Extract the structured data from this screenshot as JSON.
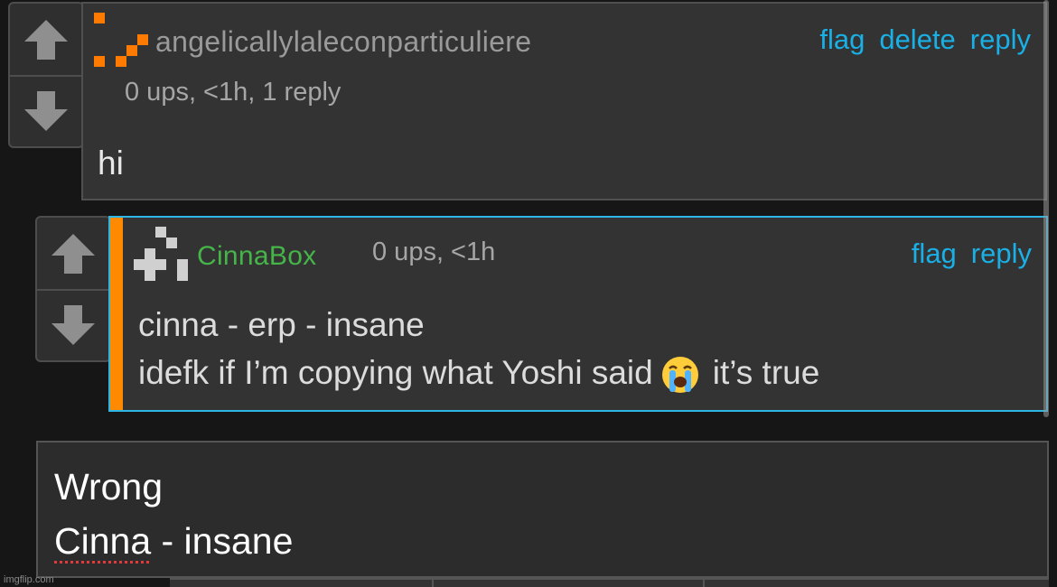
{
  "comment1": {
    "username": "angelicallylaleconparticuliere",
    "meta": "0 ups, <1h, 1 reply",
    "body": "hi",
    "actions": {
      "flag": "flag",
      "delete": "delete",
      "reply": "reply"
    }
  },
  "comment2": {
    "username": "CinnaBox",
    "meta": "0 ups, <1h",
    "line1": "cinna - erp - insane",
    "line2_before": "idefk if I’m copying what Yoshi said",
    "line2_after": "it’s true",
    "emoji": "loudly-crying-face",
    "actions": {
      "flag": "flag",
      "reply": "reply"
    }
  },
  "composer": {
    "line1": "Wrong",
    "line2_misspelled": "Cinna",
    "line2_rest": " - insane"
  },
  "watermark": "imgflip.com",
  "colors": {
    "background": "#161616",
    "panel": "#333333",
    "link": "#1ab0e6",
    "reply_border": "#2eb6e4",
    "reply_accent": "#ff8a00",
    "username_green": "#46b549",
    "avatar_orange": "#ff7a00"
  }
}
